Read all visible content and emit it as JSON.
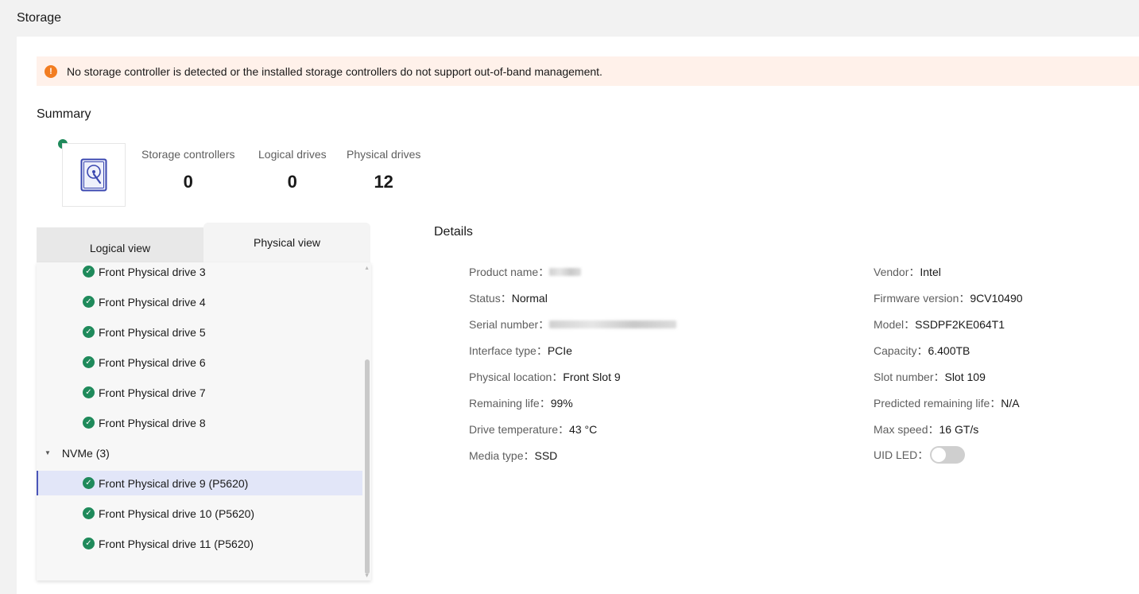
{
  "page": {
    "title": "Storage"
  },
  "alert": {
    "text": "No storage controller is detected or the installed storage controllers do not support out-of-band management."
  },
  "summary": {
    "title": "Summary",
    "stats": [
      {
        "label": "Storage controllers",
        "value": "0"
      },
      {
        "label": "Logical drives",
        "value": "0"
      },
      {
        "label": "Physical drives",
        "value": "12"
      }
    ]
  },
  "tabs": {
    "logical": "Logical view",
    "physical": "Physical view"
  },
  "tree": {
    "items": [
      {
        "label": "Front Physical drive 3"
      },
      {
        "label": "Front Physical drive 4"
      },
      {
        "label": "Front Physical drive 5"
      },
      {
        "label": "Front Physical drive 6"
      },
      {
        "label": "Front Physical drive 7"
      },
      {
        "label": "Front Physical drive 8"
      }
    ],
    "group": {
      "label": "NVMe (3)"
    },
    "nvme_items": [
      {
        "label": "Front Physical drive 9 (P5620)",
        "selected": true
      },
      {
        "label": "Front Physical drive 10 (P5620)"
      },
      {
        "label": "Front Physical drive 11 (P5620)"
      }
    ]
  },
  "details": {
    "title": "Details",
    "left": [
      {
        "label": "Product name：",
        "value": ""
      },
      {
        "label": "Status：",
        "value": "Normal"
      },
      {
        "label": "Serial number：",
        "value": ""
      },
      {
        "label": "Interface type：",
        "value": "PCIe"
      },
      {
        "label": "Physical location：",
        "value": "Front Slot 9"
      },
      {
        "label": "Remaining life：",
        "value": "99%"
      },
      {
        "label": "Drive temperature：",
        "value": "43 °C"
      },
      {
        "label": "Media type：",
        "value": "SSD"
      }
    ],
    "right": [
      {
        "label": "Vendor：",
        "value": "Intel"
      },
      {
        "label": "Firmware version：",
        "value": "9CV10490"
      },
      {
        "label": "Model：",
        "value": "SSDPF2KE064T1"
      },
      {
        "label": "Capacity：",
        "value": "6.400TB"
      },
      {
        "label": "Slot number：",
        "value": "Slot 109"
      },
      {
        "label": "Predicted remaining life：",
        "value": "N/A"
      },
      {
        "label": "Max speed：",
        "value": "16 GT/s"
      },
      {
        "label": "UID LED：",
        "value": ""
      }
    ],
    "uid_led_on": false
  },
  "colors": {
    "ok": "#1f8a5b",
    "warning": "#f27d21",
    "selection": "#e2e6f8",
    "accent": "#4a55b8"
  }
}
